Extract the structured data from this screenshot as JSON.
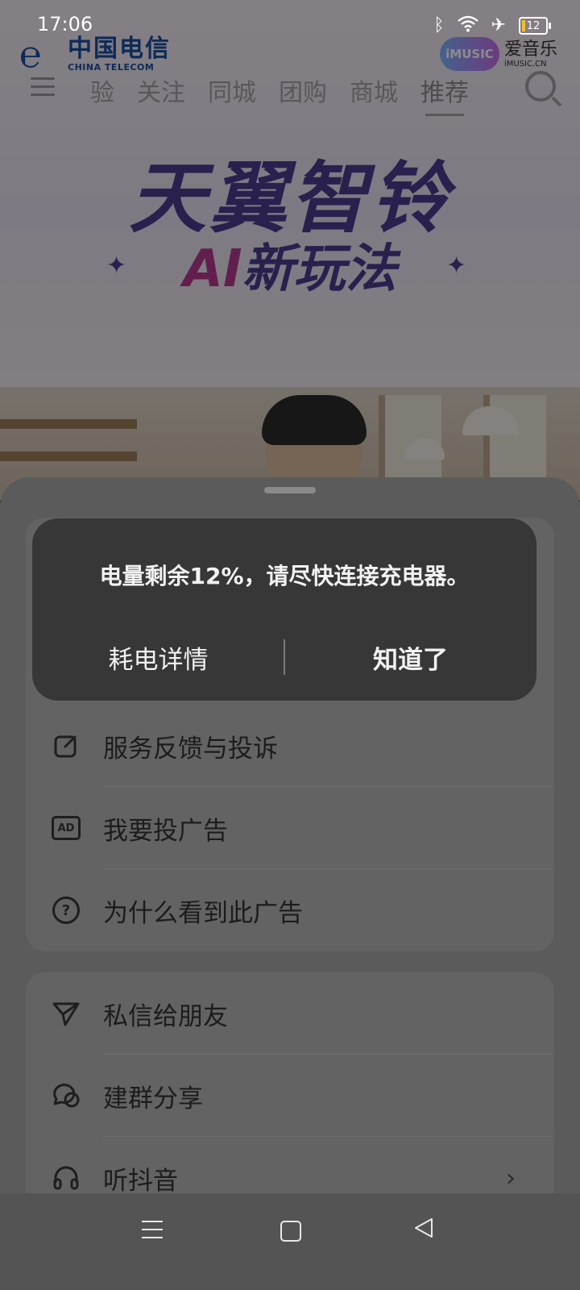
{
  "status_bar": {
    "time": "17:06",
    "battery_level": "12",
    "icons": [
      "bluetooth-icon",
      "wifi-icon",
      "airplane-icon",
      "battery-icon"
    ]
  },
  "ad": {
    "carrier_name_cn": "中国电信",
    "carrier_name_en": "CHINA TELECOM",
    "imusic_badge": "iMUSIC",
    "imusic_name_cn": "爱音乐",
    "imusic_domain": "iMUSIC.CN",
    "headline": "天翼智铃",
    "subline_ai": "AI",
    "subline_rest": "新玩法"
  },
  "app_nav": {
    "tabs": [
      "验",
      "关注",
      "同城",
      "团购",
      "商城",
      "推荐"
    ],
    "active_tab": "推荐"
  },
  "battery_toast": {
    "message": "电量剩余12%，请尽快连接充电器。",
    "details_button": "耗电详情",
    "ok_button": "知道了"
  },
  "sheet": {
    "group1": [
      {
        "label": "服务反馈与投诉",
        "icon": "edit-icon"
      },
      {
        "label": "我要投广告",
        "icon": "ad-icon"
      },
      {
        "label": "为什么看到此广告",
        "icon": "question-icon"
      }
    ],
    "group2": [
      {
        "label": "私信给朋友",
        "icon": "send-icon"
      },
      {
        "label": "建群分享",
        "icon": "group-chat-icon"
      },
      {
        "label": "听抖音",
        "icon": "headphones-icon"
      }
    ]
  },
  "colors": {
    "toast_bg": "#373737",
    "sheet_bg": "#5b5b5b",
    "card_bg": "#636363",
    "headline": "#4b3b8f",
    "brand_blue": "#1a4d9e"
  }
}
